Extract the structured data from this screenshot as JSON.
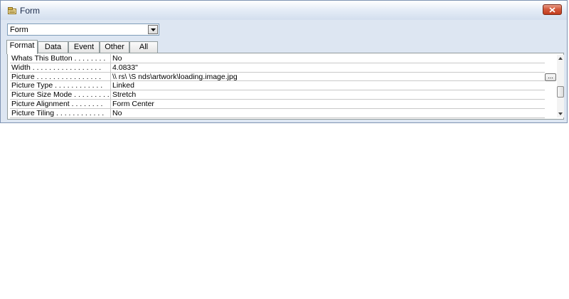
{
  "window": {
    "title": "Form",
    "close_icon": "close-icon"
  },
  "selector": {
    "value": "Form"
  },
  "tabs": [
    {
      "label": "Format",
      "active": true
    },
    {
      "label": "Data",
      "active": false
    },
    {
      "label": "Event",
      "active": false
    },
    {
      "label": "Other",
      "active": false
    },
    {
      "label": "All",
      "active": false
    }
  ],
  "properties": [
    {
      "label": "Whats This Button . . . . . . . .",
      "value": "No"
    },
    {
      "label": "Width . . . . . . . . . . . . . . . . .",
      "value": "4.0833\""
    },
    {
      "label": "Picture . . . . . . . . . . . . . . . .",
      "value": "\\\\                                                                                                                   rs\\                  \\S               nds\\artwork\\loading.image.jpg"
    },
    {
      "label": "Picture Type . . . . . . . . . . . .",
      "value": "Linked"
    },
    {
      "label": "Picture Size Mode . . . . . . . . .",
      "value": "Stretch"
    },
    {
      "label": "Picture Alignment . . . . . . . .",
      "value": "Form Center"
    },
    {
      "label": "Picture Tiling . . . . . . . . . . . .",
      "value": "No"
    }
  ],
  "builder_button": {
    "label": "..."
  },
  "colors": {
    "close_red": "#c23b1c",
    "chrome": "#dde6f2",
    "grid_line": "#c9c9c9"
  }
}
